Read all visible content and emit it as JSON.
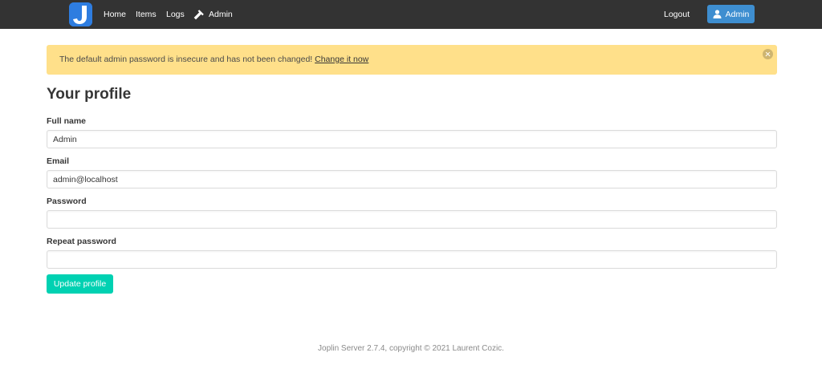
{
  "navbar": {
    "logo_letter": "J",
    "links": {
      "home": "Home",
      "items": "Items",
      "logs": "Logs",
      "admin": "Admin"
    },
    "admin_icon": "hammer-icon",
    "logout": "Logout",
    "user_button": {
      "label": "Admin",
      "icon": "user-icon"
    }
  },
  "notification": {
    "message": "The default admin password is insecure and has not been changed! ",
    "link": "Change it now",
    "close_icon": "close-icon"
  },
  "profile": {
    "title": "Your profile",
    "fields": {
      "full_name": {
        "label": "Full name",
        "value": "Admin"
      },
      "email": {
        "label": "Email",
        "value": "admin@localhost"
      },
      "password": {
        "label": "Password",
        "value": ""
      },
      "repeat_password": {
        "label": "Repeat password",
        "value": ""
      }
    },
    "submit": "Update profile"
  },
  "footer": {
    "text": "Joplin Server 2.7.4, copyright © 2021 Laurent Cozic."
  },
  "colors": {
    "navbar_bg": "#333333",
    "logo_bg": "#2e7de0",
    "user_button_bg": "#3e8ed0",
    "warning_bg": "#ffe08a",
    "submit_bg": "#00d1b2"
  }
}
